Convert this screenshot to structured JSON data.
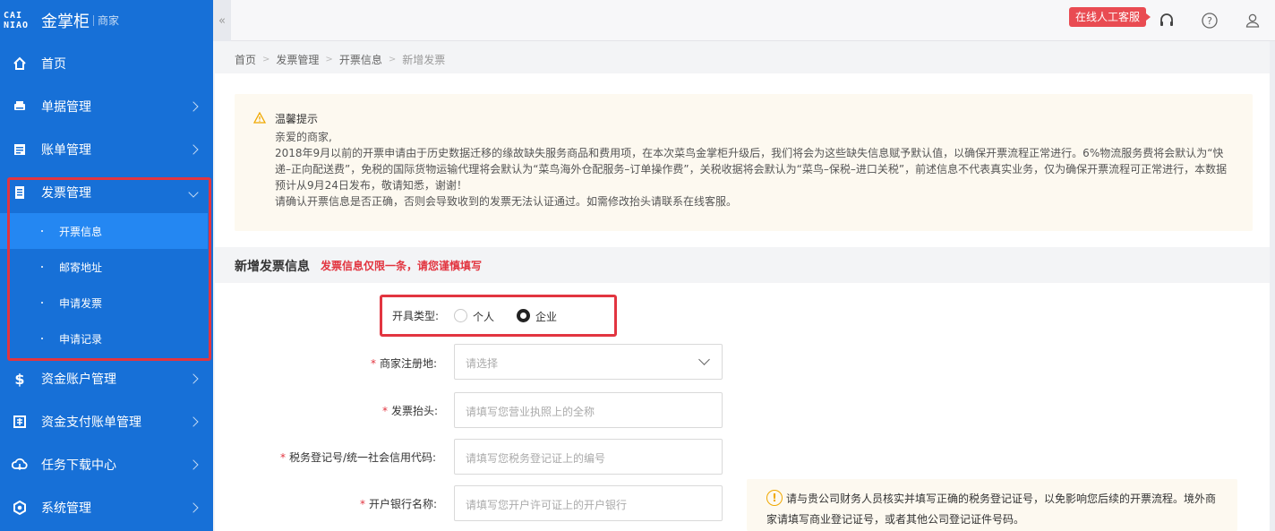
{
  "logo": {
    "mark_line1": "CAI",
    "mark_line2": "NIAO",
    "title": "金掌柜",
    "subtitle": "商家"
  },
  "sidebar": {
    "items": [
      {
        "label": "首页",
        "icon": "home-icon"
      },
      {
        "label": "单据管理",
        "icon": "printer-icon"
      },
      {
        "label": "账单管理",
        "icon": "bill-icon"
      },
      {
        "label": "发票管理",
        "icon": "invoice-icon"
      },
      {
        "label": "资金账户管理",
        "icon": "dollar-icon"
      },
      {
        "label": "资金支付账单管理",
        "icon": "payment-bill-icon"
      },
      {
        "label": "任务下载中心",
        "icon": "cloud-download-icon"
      },
      {
        "label": "系统管理",
        "icon": "settings-icon"
      }
    ],
    "submenu": [
      {
        "label": "开票信息",
        "active": true
      },
      {
        "label": "邮寄地址",
        "active": false
      },
      {
        "label": "申请发票",
        "active": false
      },
      {
        "label": "申请记录",
        "active": false
      }
    ],
    "collapse_glyph": "«"
  },
  "header": {
    "cs_label": "在线人工客服",
    "icons": [
      "headset-icon",
      "help-icon",
      "user-icon"
    ]
  },
  "breadcrumb": [
    "首页",
    "发票管理",
    "开票信息",
    "新增发票"
  ],
  "notice": {
    "title": "温馨提示",
    "lines": [
      "亲爱的商家,",
      "2018年9月以前的开票申请由于历史数据迁移的缘故缺失服务商品和费用项，在本次菜鸟金掌柜升级后，我们将会为这些缺失信息赋予默认值，以确保开票流程正常进行。6%物流服务费将会默认为“快递–正向配送费”，免税的国际货物运输代理将会默认为“菜鸟海外仓配服务–订单操作费”，关税收据将会默认为“菜鸟–保税–进口关税”，前述信息不代表真实业务，仅为确保开票流程可正常进行，本数据预计从9月24日发布，敬请知悉，谢谢！",
      "请确认开票信息是否正确，否则会导致收到的发票无法认证通过。如需修改抬头请联系在线客服。"
    ]
  },
  "section": {
    "title": "新增发票信息",
    "warning": "发票信息仅限一条，请您谨慎填写"
  },
  "form": {
    "type_label": "开具类型:",
    "type_options": [
      {
        "label": "个人",
        "checked": false
      },
      {
        "label": "企业",
        "checked": true
      }
    ],
    "required_mark": "*",
    "region_label": "商家注册地:",
    "region_placeholder": "请选择",
    "title_label": "发票抬头:",
    "title_placeholder": "请填写您营业执照上的全称",
    "tax_label": "税务登记号/统一社会信用代码:",
    "tax_placeholder": "请填写您税务登记证上的编号",
    "bank_label": "开户银行名称:",
    "bank_placeholder": "请填写您开户许可证上的开户银行"
  },
  "tip": {
    "icon": "exclamation-icon",
    "text": "请与贵公司财务人员核实并填写正确的税务登记证号，以免影响您后续的开票流程。境外商家请填写商业登记证号，或者其他公司登记证件号码。"
  },
  "colors": {
    "sidebar": "#1770d7",
    "submenu_active": "#2487f2",
    "highlight": "#e23540",
    "notice_bg": "#fdf9f0"
  }
}
